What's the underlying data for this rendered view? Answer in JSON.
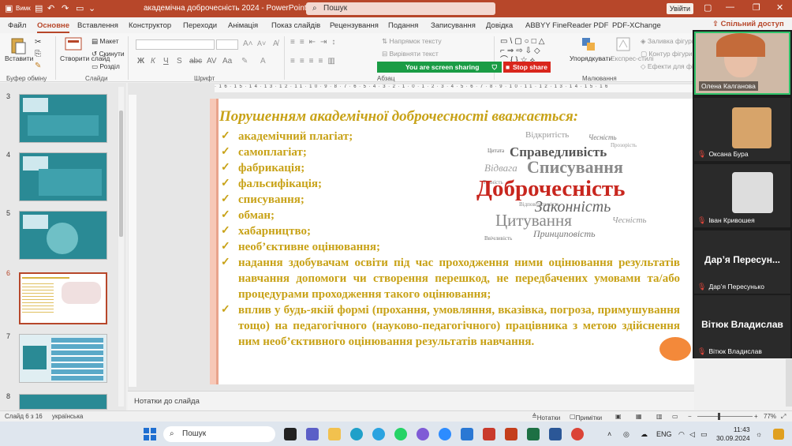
{
  "titlebar": {
    "autosave": "Вимк",
    "title": "академічна доброчесність 2024 - PowerPoint",
    "search_placeholder": "Пошук",
    "signin": "Увійти"
  },
  "menu": {
    "tabs": [
      "Файл",
      "Основне",
      "Вставлення",
      "Конструктор",
      "Переходи",
      "Анімація",
      "Показ слайдів",
      "Рецензування",
      "Подання",
      "Записування",
      "Довідка",
      "ABBYY FineReader PDF",
      "PDF-XChange"
    ],
    "active": "Основне",
    "share": "Спільний доступ"
  },
  "ribbon": {
    "paste": "Вставити",
    "create_slide": "Створити слайд",
    "layout": "Макет",
    "reset": "Скинути",
    "section": "Розділ",
    "text_direction": "Напрямок тексту",
    "align_text": "Вирівняти текст",
    "arrange": "Упорядкувати",
    "quick_styles": "Експрес-стилі",
    "shape_fill": "Заливка фігури",
    "shape_outline": "Контур фігури",
    "shape_effects": "Ефекти для фігур",
    "groups": {
      "clipboard": "Буфер обміну",
      "slides": "Слайди",
      "font": "Шрифт",
      "paragraph": "Абзац",
      "drawing": "Малювання"
    },
    "screen_sharing": "You are screen sharing",
    "stop_share": "Stop share"
  },
  "thumbnails": {
    "numbers": [
      "3",
      "4",
      "5",
      "6",
      "7",
      "8"
    ],
    "selected": "6"
  },
  "slide": {
    "title": "Порушенням академічної доброчесності вважається:",
    "bullets": [
      "академічний плагіат;",
      "самоплагіат;",
      "фабрикація;",
      "фальсифікація;",
      "списування;",
      "обман;",
      "хабарництво;",
      "необ’єктивне оцінювання;",
      "надання здобувачам освіти під час проходження ними оцінювання результатів навчання допомоги чи створення перешкод, не передбачених умовами та/або процедурами проходження такого оцінювання;",
      "вплив у будь-якій формі (прохання, умовляння, вказівка, погроза, примушування тощо) на педагогічного (науково-педагогічного) працівника з метою здійснення ним необ’єктивного оцінювання результатів навчання."
    ],
    "wordcloud": {
      "dobrochesnist": "Доброчесність",
      "spysuvannia": "Списування",
      "zakonnist": "Законність",
      "tsytuvannia": "Цитування",
      "spravedlyvist": "Справедливість",
      "vidkrytist": "Відкритість",
      "chesnist": "Чесність",
      "vidvaha": "Відвага",
      "pryntsypovist": "Принциповість",
      "prozorist": "Прозорість",
      "tsytata": "Цитата",
      "vidpovidalnist": "Відповідальність",
      "tochnist": "Точність",
      "vvichlyvist": "Ввічливість"
    }
  },
  "notes_placeholder": "Нотатки до слайда",
  "participants": [
    {
      "name": "Олена Калганова",
      "muted": false
    },
    {
      "name": "Оксана Бура",
      "muted": true
    },
    {
      "name": "Іван Кривошея",
      "muted": true
    },
    {
      "name": "Дар’я Пересунько",
      "display": "Дар’я Пересун...",
      "muted": true
    },
    {
      "name": "Вітюк Владислав",
      "display": "Вітюк Владислав",
      "muted": true
    }
  ],
  "statusbar": {
    "slide_info": "Слайд 6 з 16",
    "language": "українська",
    "notes": "Нотатки",
    "comments": "Примітки",
    "zoom": "77%"
  },
  "taskbar": {
    "search": "Пошук",
    "lang": "ENG",
    "time": "11:43",
    "date": "30.09.2024"
  },
  "colors": {
    "accent": "#b7472a",
    "slide_text": "#c8a217",
    "share_green": "#1a9c45",
    "stop_red": "#d9261c"
  }
}
